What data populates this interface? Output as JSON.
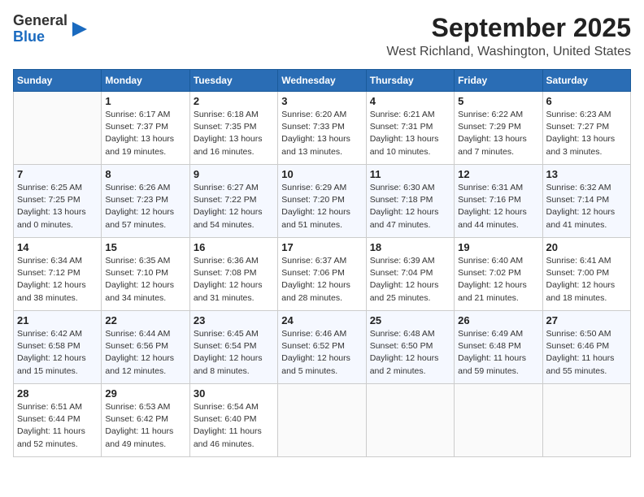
{
  "logo": {
    "general": "General",
    "blue": "Blue"
  },
  "title": "September 2025",
  "location": "West Richland, Washington, United States",
  "weekdays": [
    "Sunday",
    "Monday",
    "Tuesday",
    "Wednesday",
    "Thursday",
    "Friday",
    "Saturday"
  ],
  "weeks": [
    [
      {
        "day": "",
        "info": ""
      },
      {
        "day": "1",
        "info": "Sunrise: 6:17 AM\nSunset: 7:37 PM\nDaylight: 13 hours\nand 19 minutes."
      },
      {
        "day": "2",
        "info": "Sunrise: 6:18 AM\nSunset: 7:35 PM\nDaylight: 13 hours\nand 16 minutes."
      },
      {
        "day": "3",
        "info": "Sunrise: 6:20 AM\nSunset: 7:33 PM\nDaylight: 13 hours\nand 13 minutes."
      },
      {
        "day": "4",
        "info": "Sunrise: 6:21 AM\nSunset: 7:31 PM\nDaylight: 13 hours\nand 10 minutes."
      },
      {
        "day": "5",
        "info": "Sunrise: 6:22 AM\nSunset: 7:29 PM\nDaylight: 13 hours\nand 7 minutes."
      },
      {
        "day": "6",
        "info": "Sunrise: 6:23 AM\nSunset: 7:27 PM\nDaylight: 13 hours\nand 3 minutes."
      }
    ],
    [
      {
        "day": "7",
        "info": "Sunrise: 6:25 AM\nSunset: 7:25 PM\nDaylight: 13 hours\nand 0 minutes."
      },
      {
        "day": "8",
        "info": "Sunrise: 6:26 AM\nSunset: 7:23 PM\nDaylight: 12 hours\nand 57 minutes."
      },
      {
        "day": "9",
        "info": "Sunrise: 6:27 AM\nSunset: 7:22 PM\nDaylight: 12 hours\nand 54 minutes."
      },
      {
        "day": "10",
        "info": "Sunrise: 6:29 AM\nSunset: 7:20 PM\nDaylight: 12 hours\nand 51 minutes."
      },
      {
        "day": "11",
        "info": "Sunrise: 6:30 AM\nSunset: 7:18 PM\nDaylight: 12 hours\nand 47 minutes."
      },
      {
        "day": "12",
        "info": "Sunrise: 6:31 AM\nSunset: 7:16 PM\nDaylight: 12 hours\nand 44 minutes."
      },
      {
        "day": "13",
        "info": "Sunrise: 6:32 AM\nSunset: 7:14 PM\nDaylight: 12 hours\nand 41 minutes."
      }
    ],
    [
      {
        "day": "14",
        "info": "Sunrise: 6:34 AM\nSunset: 7:12 PM\nDaylight: 12 hours\nand 38 minutes."
      },
      {
        "day": "15",
        "info": "Sunrise: 6:35 AM\nSunset: 7:10 PM\nDaylight: 12 hours\nand 34 minutes."
      },
      {
        "day": "16",
        "info": "Sunrise: 6:36 AM\nSunset: 7:08 PM\nDaylight: 12 hours\nand 31 minutes."
      },
      {
        "day": "17",
        "info": "Sunrise: 6:37 AM\nSunset: 7:06 PM\nDaylight: 12 hours\nand 28 minutes."
      },
      {
        "day": "18",
        "info": "Sunrise: 6:39 AM\nSunset: 7:04 PM\nDaylight: 12 hours\nand 25 minutes."
      },
      {
        "day": "19",
        "info": "Sunrise: 6:40 AM\nSunset: 7:02 PM\nDaylight: 12 hours\nand 21 minutes."
      },
      {
        "day": "20",
        "info": "Sunrise: 6:41 AM\nSunset: 7:00 PM\nDaylight: 12 hours\nand 18 minutes."
      }
    ],
    [
      {
        "day": "21",
        "info": "Sunrise: 6:42 AM\nSunset: 6:58 PM\nDaylight: 12 hours\nand 15 minutes."
      },
      {
        "day": "22",
        "info": "Sunrise: 6:44 AM\nSunset: 6:56 PM\nDaylight: 12 hours\nand 12 minutes."
      },
      {
        "day": "23",
        "info": "Sunrise: 6:45 AM\nSunset: 6:54 PM\nDaylight: 12 hours\nand 8 minutes."
      },
      {
        "day": "24",
        "info": "Sunrise: 6:46 AM\nSunset: 6:52 PM\nDaylight: 12 hours\nand 5 minutes."
      },
      {
        "day": "25",
        "info": "Sunrise: 6:48 AM\nSunset: 6:50 PM\nDaylight: 12 hours\nand 2 minutes."
      },
      {
        "day": "26",
        "info": "Sunrise: 6:49 AM\nSunset: 6:48 PM\nDaylight: 11 hours\nand 59 minutes."
      },
      {
        "day": "27",
        "info": "Sunrise: 6:50 AM\nSunset: 6:46 PM\nDaylight: 11 hours\nand 55 minutes."
      }
    ],
    [
      {
        "day": "28",
        "info": "Sunrise: 6:51 AM\nSunset: 6:44 PM\nDaylight: 11 hours\nand 52 minutes."
      },
      {
        "day": "29",
        "info": "Sunrise: 6:53 AM\nSunset: 6:42 PM\nDaylight: 11 hours\nand 49 minutes."
      },
      {
        "day": "30",
        "info": "Sunrise: 6:54 AM\nSunset: 6:40 PM\nDaylight: 11 hours\nand 46 minutes."
      },
      {
        "day": "",
        "info": ""
      },
      {
        "day": "",
        "info": ""
      },
      {
        "day": "",
        "info": ""
      },
      {
        "day": "",
        "info": ""
      }
    ]
  ]
}
